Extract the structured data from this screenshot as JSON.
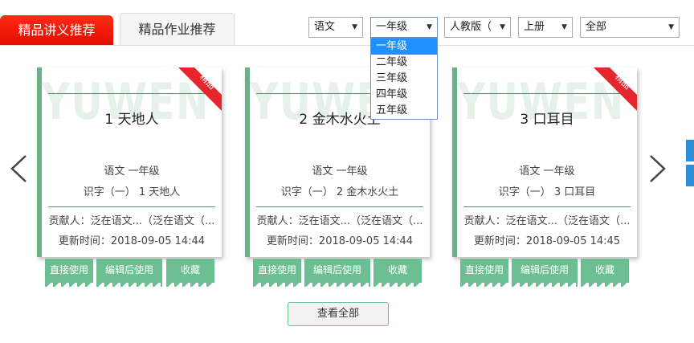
{
  "tabs": [
    {
      "label": "精品讲义推荐",
      "active": true
    },
    {
      "label": "精品作业推荐",
      "active": false
    }
  ],
  "filters": {
    "subject": "语文",
    "grade": "一年级",
    "edition": "人教版（",
    "volume": "上册",
    "unit": "全部"
  },
  "grade_dropdown": {
    "options": [
      "一年级",
      "二年级",
      "三年级",
      "四年级",
      "五年级"
    ],
    "selected_index": 0
  },
  "watermark": "YUWEN",
  "ribbon_text": "精品",
  "cards": [
    {
      "title": "1 天地人",
      "subject_grade": "语文  一年级",
      "lesson": "识字（一）  1 天地人",
      "contributor": "贡献人：泛在语文...（泛在语文（...",
      "updated": "更新时间：2018-09-05 14:44",
      "has_ribbon": true
    },
    {
      "title": "2 金木水火土",
      "subject_grade": "语文  一年级",
      "lesson": "识字（一）  2 金木水火土",
      "contributor": "贡献人：泛在语文...（泛在语文（...",
      "updated": "更新时间：2018-09-05 14:44",
      "has_ribbon": false
    },
    {
      "title": "3 口耳目",
      "subject_grade": "语文  一年级",
      "lesson": "识字（一）  3 口耳目",
      "contributor": "贡献人：泛在语文...（泛在语文（...",
      "updated": "更新时间：2018-09-05 14:45",
      "has_ribbon": true
    }
  ],
  "card_buttons": {
    "use": "直接使用",
    "edit": "编辑后使用",
    "favorite": "收藏"
  },
  "view_all": "查看全部",
  "colors": {
    "active_tab": "#e30d00",
    "accent_green": "#6cbf92",
    "dropdown_highlight": "#1e90ff"
  }
}
